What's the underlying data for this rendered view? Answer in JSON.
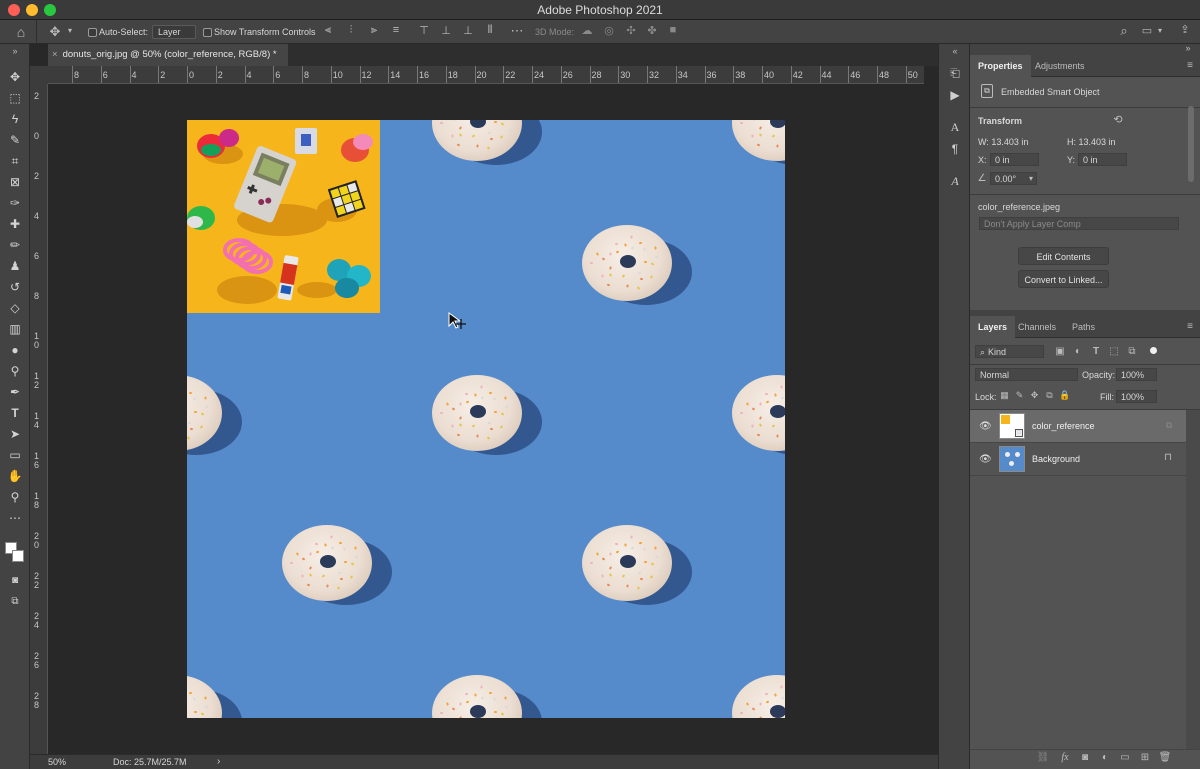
{
  "window": {
    "title": "Adobe Photoshop 2021"
  },
  "options": {
    "auto_select_label": "Auto-Select:",
    "auto_select_value": "Layer",
    "show_transform_label": "Show Transform Controls",
    "mode_3d_label": "3D Mode:"
  },
  "document": {
    "tab_title": "donuts_orig.jpg @ 50% (color_reference, RGB/8) *",
    "close_glyph": "×"
  },
  "ruler": {
    "top_ticks": [
      "8",
      "6",
      "4",
      "2",
      "0",
      "2",
      "4",
      "6",
      "8",
      "10",
      "12",
      "14",
      "16",
      "18",
      "20",
      "22",
      "24",
      "26",
      "28",
      "30",
      "32",
      "34",
      "36",
      "38",
      "40",
      "42",
      "44",
      "46",
      "48",
      "50"
    ],
    "left_ticks": [
      "2",
      "0",
      "2",
      "4",
      "6",
      "8",
      "1 0",
      "1 2",
      "1 4",
      "1 6",
      "1 8",
      "2 0",
      "2 2",
      "2 4",
      "2 6",
      "2 8"
    ]
  },
  "status": {
    "zoom": "50%",
    "doc_size": "Doc: 25.7M/25.7M",
    "arrow": "›"
  },
  "properties": {
    "tabs": [
      "Properties",
      "Adjustments"
    ],
    "object_type": "Embedded Smart Object",
    "transform_heading": "Transform",
    "w_label": "W:",
    "w_value": "13.403 in",
    "h_label": "H:",
    "h_value": "13.403 in",
    "x_label": "X:",
    "x_value": "0 in",
    "y_label": "Y:",
    "y_value": "0 in",
    "angle_value": "0.00°",
    "filename": "color_reference.jpeg",
    "layer_comp": "Don't Apply Layer Comp",
    "edit_contents": "Edit Contents",
    "convert_linked": "Convert to Linked..."
  },
  "layers": {
    "tabs": [
      "Layers",
      "Channels",
      "Paths"
    ],
    "kind_label": "Kind",
    "blend_mode": "Normal",
    "opacity_label": "Opacity:",
    "opacity_value": "100%",
    "lock_label": "Lock:",
    "fill_label": "Fill:",
    "fill_value": "100%",
    "items": [
      {
        "name": "color_reference"
      },
      {
        "name": "Background"
      }
    ]
  },
  "colors": {
    "canvas_bg": "#558acb",
    "reference_bg": "#f7b51c",
    "panel_bg": "#535353"
  }
}
